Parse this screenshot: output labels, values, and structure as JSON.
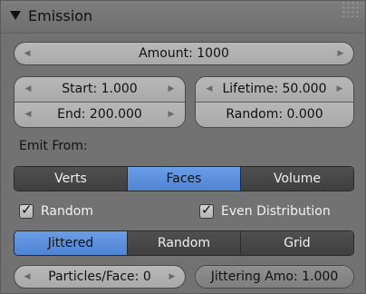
{
  "panel": {
    "title": "Emission"
  },
  "amount": {
    "label": "Amount: 1000"
  },
  "start": {
    "label": "Start: 1.000"
  },
  "end": {
    "label": "End: 200.000"
  },
  "lifetime": {
    "label": "Lifetime: 50.000"
  },
  "lifetime_random": {
    "label": "Random: 0.000",
    "fill": 0.0
  },
  "emit_from": {
    "label": "Emit From:",
    "options": [
      "Verts",
      "Faces",
      "Volume"
    ],
    "selected": "Faces"
  },
  "checks": {
    "random": {
      "label": "Random",
      "checked": true
    },
    "even_distribution": {
      "label": "Even Distribution",
      "checked": true
    }
  },
  "distribution": {
    "options": [
      "Jittered",
      "Random",
      "Grid"
    ],
    "selected": "Jittered"
  },
  "particles_per_face": {
    "label": "Particles/Face: 0"
  },
  "jittering_amount": {
    "label": "Jittering Amo: 1.000",
    "fill": 1.0
  },
  "colors": {
    "panel_bg": "#727272",
    "field_bg": "#b0b0b0",
    "button_dark": "#474747",
    "accent": "#5b8fdc"
  },
  "icons": {
    "collapse": "triangle-down-icon",
    "decrement": "arrow-left-icon",
    "increment": "arrow-right-icon",
    "check": "checkmark-icon",
    "grip": "drag-grip-icon"
  }
}
